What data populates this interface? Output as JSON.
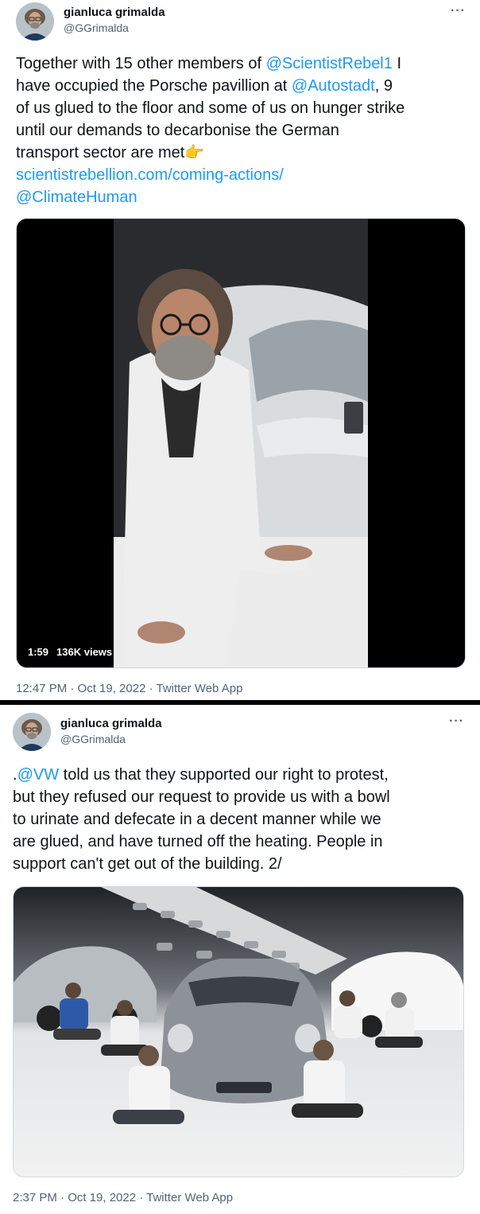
{
  "tweets": [
    {
      "author": {
        "name": "gianluca grimalda",
        "handle": "@GGrimalda"
      },
      "more_label": "···",
      "text": {
        "line1_pre": "Together with 15 other members of ",
        "line1_link": "@ScientistRebel1",
        "line1_post": "  I",
        "line2_pre": "have occupied the Porsche pavillion at ",
        "line2_link": "@Autostadt",
        "line2_post": ", 9",
        "line3": "of us glued to the floor and some of us on hunger strike",
        "line4": "until our demands to decarbonise the German",
        "line5": "transport sector are met👉",
        "line6_link": "scientistrebellion.com/coming-actions/",
        "line7_link": "@ClimateHuman"
      },
      "video": {
        "duration": "1:59",
        "views": "136K views"
      },
      "meta": "12:47 PM · Oct 19, 2022 · Twitter Web App"
    },
    {
      "author": {
        "name": "gianluca grimalda",
        "handle": "@GGrimalda"
      },
      "more_label": "···",
      "text": {
        "line1_pre": ".",
        "line1_link": "@VW",
        "line1_post": " told us that they supported our right to protest,",
        "line2": "but they refused our request to provide us with a bowl",
        "line3": "to urinate and defecate in a decent manner while we",
        "line4": "are glued, and have turned off the heating. People in",
        "line5": "support can't get out of the building. 2/"
      },
      "meta": "2:37 PM · Oct 19, 2022 · Twitter Web App"
    }
  ]
}
